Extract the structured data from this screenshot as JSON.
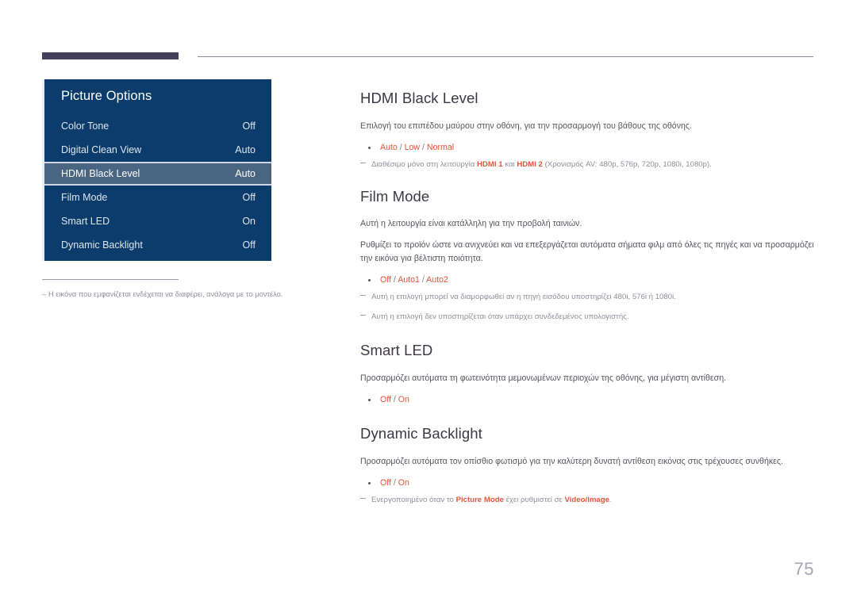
{
  "page": {
    "number": "75",
    "accent_color": "#e2563c",
    "osd_bg_color": "#0b3c6b",
    "osd_highlight_color": "#4a6582",
    "heading_color": "#3c3645"
  },
  "osd": {
    "title": "Picture Options",
    "rows": [
      {
        "label": "Color Tone",
        "value": "Off",
        "selected": false
      },
      {
        "label": "Digital Clean View",
        "value": "Auto",
        "selected": false
      },
      {
        "label": "HDMI Black Level",
        "value": "Auto",
        "selected": true
      },
      {
        "label": "Film Mode",
        "value": "Off",
        "selected": false
      },
      {
        "label": "Smart LED",
        "value": "On",
        "selected": false
      },
      {
        "label": "Dynamic Backlight",
        "value": "Off",
        "selected": false
      }
    ]
  },
  "left_note": {
    "dash": "–",
    "text": "Η εικόνα που εμφανίζεται ενδέχεται να διαφέρει, ανάλογα με το μοντέλο."
  },
  "sections": {
    "hdmi_black_level": {
      "title": "HDMI Black Level",
      "paragraph": "Επιλογή του επιπέδου μαύρου στην οθόνη, για την προσαρμογή του βάθους της οθόνης.",
      "options": "Auto / Low / Normal",
      "option_parts": {
        "a": "Auto",
        "sep1": " / ",
        "b": "Low",
        "sep2": " / ",
        "c": "Normal"
      },
      "note": {
        "pre": "Διαθέσιμο μόνο στη λειτουργία ",
        "hl1": "HDMI 1",
        "mid": " και ",
        "hl2": "HDMI 2",
        "post": " (Χρονισμός AV: 480p, 576p, 720p, 1080i, 1080p)."
      }
    },
    "film_mode": {
      "title": "Film Mode",
      "paragraph1": "Αυτή η λειτουργία είναι κατάλληλη για την προβολή ταινιών.",
      "paragraph2": "Ρυθμίζει το προϊόν ώστε να ανιχνεύει και να επεξεργάζεται αυτόματα σήματα φιλμ από όλες τις πηγές και να προσαρμόζει την εικόνα για βέλτιστη ποιότητα.",
      "option_parts": {
        "a": "Off",
        "sep1": " / ",
        "b": "Auto1",
        "sep2": " / ",
        "c": "Auto2"
      },
      "note1": "Αυτή η επιλογή μπορεί να διαμορφωθεί αν η πηγή εισόδου υποστηρίζει 480i, 576i ή 1080i.",
      "note2": "Αυτή η επιλογή δεν υποστηρίζεται όταν υπάρχει συνδεδεμένος υπολογιστής."
    },
    "smart_led": {
      "title": "Smart LED",
      "paragraph": "Προσαρμόζει αυτόματα τη φωτεινότητα μεμονωμένων περιοχών της οθόνης, για μέγιστη αντίθεση.",
      "option_parts": {
        "a": "Off",
        "sep1": " / ",
        "b": "On"
      }
    },
    "dynamic_backlight": {
      "title": "Dynamic Backlight",
      "paragraph": "Προσαρμόζει αυτόματα τον οπίσθιο φωτισμό για την καλύτερη δυνατή αντίθεση εικόνας στις τρέχουσες συνθήκες.",
      "option_parts": {
        "a": "Off",
        "sep1": " / ",
        "b": "On"
      },
      "note": {
        "pre": "Ενεργοποιημένο όταν το ",
        "hl1": "Picture Mode",
        "mid": " έχει ρυθμιστεί σε ",
        "hl2": "Video/Image",
        "post": "."
      }
    }
  }
}
